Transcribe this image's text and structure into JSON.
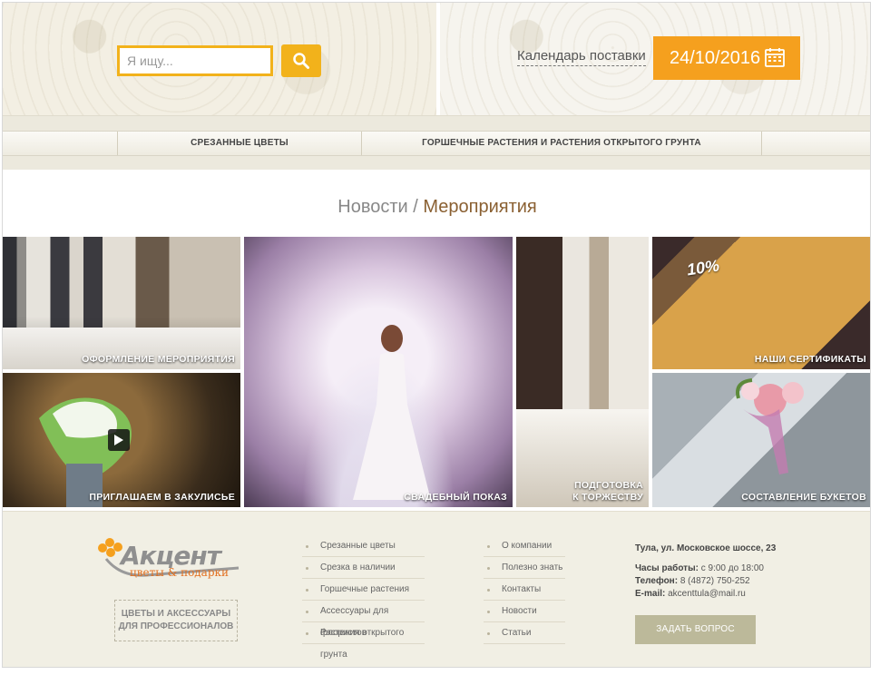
{
  "header": {
    "search": {
      "placeholder": "Я ищу...",
      "icon": "search-icon"
    },
    "calendar_link": "Календарь поставки",
    "date_value": "24/10/2016"
  },
  "menu": {
    "items": [
      {
        "label": "СРЕЗАННЫЕ ЦВЕТЫ"
      },
      {
        "label": "ГОРШЕЧНЫЕ РАСТЕНИЯ И РАСТЕНИЯ ОТКРЫТОГО ГРУНТА"
      }
    ]
  },
  "breadcrumb": {
    "parent": "Новости",
    "separator": "/",
    "current": "Мероприятия"
  },
  "tiles": [
    {
      "caption": "ОФОРМЛЕНИЕ МЕРОПРИЯТИЯ"
    },
    {
      "caption": "СВАДЕБНЫЙ ПОКАЗ"
    },
    {
      "caption_line1": "ПОДГОТОВКА",
      "caption_line2": "К ТОРЖЕСТВУ"
    },
    {
      "caption": "НАШИ СЕРТИФИКАТЫ",
      "cert_text": "10%"
    },
    {
      "caption": "ПРИГЛАШАЕМ В ЗАКУЛИСЬЕ"
    },
    {
      "caption": "СОСТАВЛЕНИЕ БУКЕТОВ"
    }
  ],
  "footer": {
    "logo": {
      "name": "Акцент",
      "tagline": "цветы & подарки"
    },
    "pro_line1": "ЦВЕТЫ И АКСЕССУАРЫ",
    "pro_line2": "ДЛЯ ПРОФЕССИОНАЛОВ",
    "catalog_links": [
      "Срезанные цветы",
      "Срезка в наличии",
      "Горшечные растения",
      "Ассессуары для флористов",
      "Растения открытого грунта"
    ],
    "info_links": [
      "О компании",
      "Полезно знать",
      "Контакты",
      "Новости",
      "Статьи"
    ],
    "contacts": {
      "address": "Тула, ул. Московское шоссе, 23",
      "hours_label": "Часы работы:",
      "hours_value": "с 9:00 до 18:00",
      "phone_label": "Телефон:",
      "phone_value": "8 (4872) 750-252",
      "email_label": "E-mail:",
      "email_value": "akcenttula@mail.ru"
    },
    "ask_button": "ЗАДАТЬ ВОПРОС"
  },
  "colors": {
    "accent_yellow": "#f2b21b",
    "accent_orange": "#f5a01e",
    "title_brown": "#8a6032",
    "footer_bg": "#f1efe4"
  }
}
